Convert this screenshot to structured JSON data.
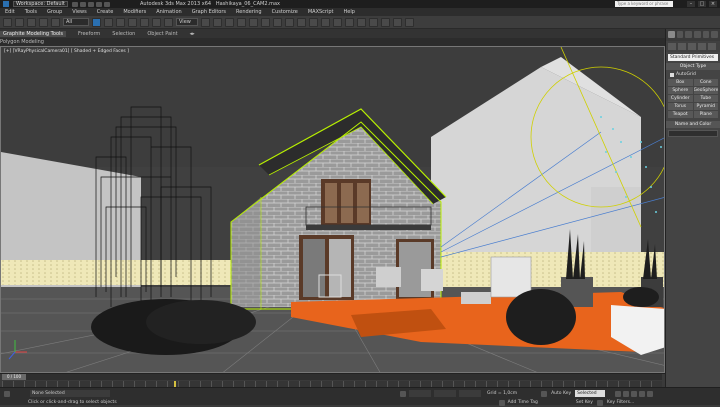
{
  "titlebar": {
    "workspace": "Workspace: Default",
    "app_title": "Autodesk 3ds Max 2013 x64",
    "file_name": "Hashikaya_06_CAM2.max",
    "search_placeholder": "Type a keyword or phrase"
  },
  "menu": [
    "Edit",
    "Tools",
    "Group",
    "Views",
    "Create",
    "Modifiers",
    "Animation",
    "Graph Editors",
    "Rendering",
    "Customize",
    "MAXScript",
    "Help"
  ],
  "toolbar": {
    "filter": "All",
    "ref_coord": "View"
  },
  "ribbon": {
    "tabs": [
      "Graphite Modeling Tools",
      "Freeform",
      "Selection",
      "Object Paint"
    ],
    "sub": "Polygon Modeling"
  },
  "viewport": {
    "label": "[+] [VRayPhysicalCamera01] [ Shaded + Edged Faces ]"
  },
  "command_panel": {
    "category": "Standard Primitives",
    "rollout_object_type": "Object Type",
    "autogrid": "AutoGrid",
    "objects": [
      "Box",
      "Cone",
      "Sphere",
      "GeoSphere",
      "Cylinder",
      "Tube",
      "Torus",
      "Pyramid",
      "Teapot",
      "Plane"
    ],
    "rollout_name_color": "Name and Color"
  },
  "timeline": {
    "frame_counter": "0 / 100"
  },
  "status": {
    "selection": "None Selected",
    "prompt": "Click or click-and-drag to select objects",
    "grid": "Grid = 1,0cm",
    "add_time_tag": "Add Time Tag",
    "auto_key": "Auto Key",
    "set_key": "Set Key",
    "key_mode": "Selected",
    "key_filters": "Key Filters..."
  },
  "colors": {
    "accent": "#2a6fb0",
    "floor": "#e8641c",
    "wire_green": "#b8f000",
    "sky": "#d8d8d8"
  }
}
